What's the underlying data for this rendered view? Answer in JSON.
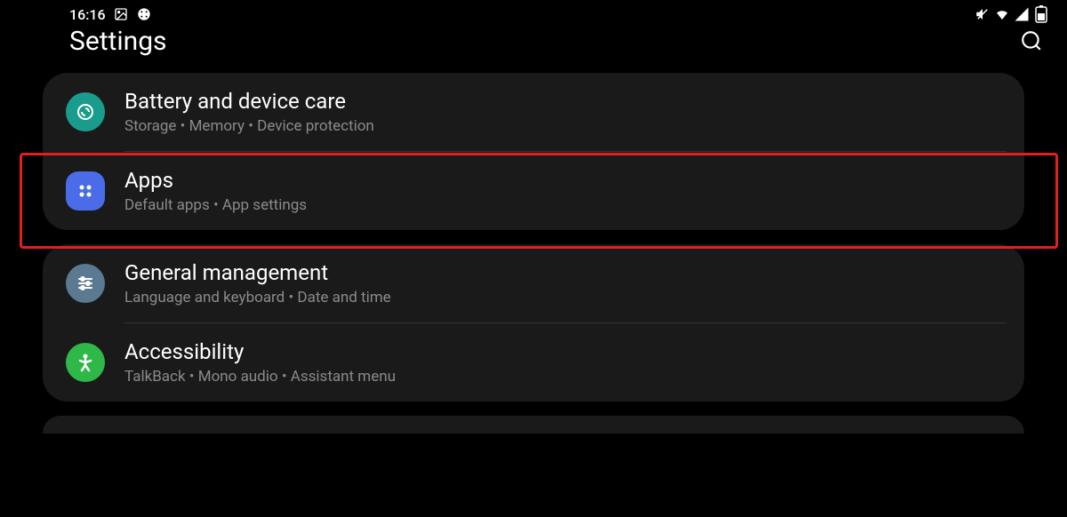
{
  "status_bar": {
    "time": "16:16",
    "icons": {
      "image": "image-icon",
      "dice": "dice-icon",
      "mute": "mute-icon",
      "wifi": "wifi-icon",
      "signal": "signal-icon",
      "battery": "battery-icon"
    }
  },
  "header": {
    "title": "Settings"
  },
  "groups": [
    {
      "items": [
        {
          "icon_name": "device-care-icon",
          "icon_color": "teal",
          "title": "Battery and device care",
          "subtitle": "Storage  •  Memory  •  Device protection"
        },
        {
          "icon_name": "apps-icon",
          "icon_color": "blue",
          "title": "Apps",
          "subtitle": "Default apps  •  App settings",
          "highlighted": true
        }
      ]
    },
    {
      "items": [
        {
          "icon_name": "general-management-icon",
          "icon_color": "bluegray",
          "title": "General management",
          "subtitle": "Language and keyboard  •  Date and time"
        },
        {
          "icon_name": "accessibility-icon",
          "icon_color": "green",
          "title": "Accessibility",
          "subtitle": "TalkBack  •  Mono audio  •  Assistant menu"
        }
      ]
    }
  ]
}
